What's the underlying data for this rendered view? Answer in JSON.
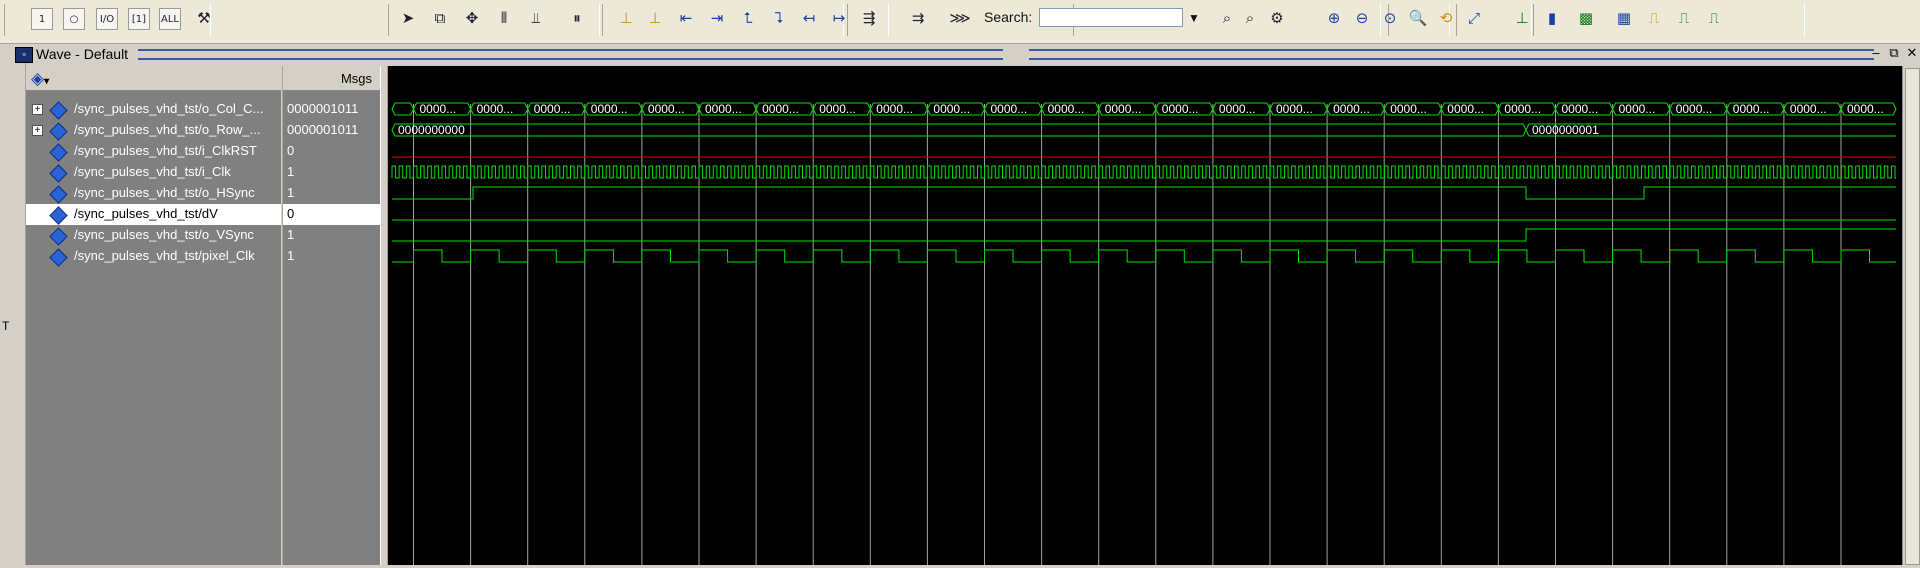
{
  "toolbar": {
    "search_label": "Search:",
    "search_value": "",
    "buttons": [
      {
        "name": "logic-1-icon",
        "glyph": "1"
      },
      {
        "name": "restart-icon",
        "glyph": "○"
      },
      {
        "name": "io-icon",
        "glyph": "I/O"
      },
      {
        "name": "bracket-icon",
        "glyph": "[1]"
      },
      {
        "name": "all-icon",
        "glyph": "ALL"
      },
      {
        "name": "tools-icon",
        "glyph": "⚒"
      },
      {
        "name": "select-cursor-icon",
        "glyph": "➤"
      },
      {
        "name": "zoom-box-icon",
        "glyph": "⧉"
      },
      {
        "name": "pan-icon",
        "glyph": "✥"
      },
      {
        "name": "cursor-pair-icon",
        "glyph": "⫴"
      },
      {
        "name": "insert-cursor-icon",
        "glyph": "⫫"
      },
      {
        "name": "stop-run-icon",
        "glyph": "⏸"
      },
      {
        "name": "add-cursor-icon",
        "glyph": "⊥"
      },
      {
        "name": "remove-cursor-icon",
        "glyph": "⊥"
      },
      {
        "name": "prev-edge-icon",
        "glyph": "⇤"
      },
      {
        "name": "next-edge-icon",
        "glyph": "⇥"
      },
      {
        "name": "prev-transition-icon",
        "glyph": "⮤"
      },
      {
        "name": "next-transition-icon",
        "glyph": "⮧"
      },
      {
        "name": "find-previous-icon",
        "glyph": "↤"
      },
      {
        "name": "find-next-icon",
        "glyph": "↦"
      },
      {
        "name": "expand-bus-icon",
        "glyph": "⇶"
      },
      {
        "name": "collapse-bus-icon",
        "glyph": "⇉"
      },
      {
        "name": "split-icon",
        "glyph": "⋙"
      },
      {
        "name": "search-previous-icon",
        "glyph": "⌕"
      },
      {
        "name": "search-next-icon",
        "glyph": "⌕"
      },
      {
        "name": "search-options-icon",
        "glyph": "⚙"
      },
      {
        "name": "zoom-in-icon",
        "glyph": "⊕"
      },
      {
        "name": "zoom-out-icon",
        "glyph": "⊖"
      },
      {
        "name": "zoom-full-icon",
        "glyph": "⊙"
      },
      {
        "name": "zoom-cursor-icon",
        "glyph": "🔍"
      },
      {
        "name": "zoom-last-icon",
        "glyph": "⟲"
      },
      {
        "name": "zoom-range-icon",
        "glyph": "⤢"
      },
      {
        "name": "wave-style-1-icon",
        "glyph": "⊥"
      },
      {
        "name": "wave-style-2-icon",
        "glyph": "▮"
      },
      {
        "name": "wave-style-3-icon",
        "glyph": "▩"
      },
      {
        "name": "wave-style-4-icon",
        "glyph": "▦"
      },
      {
        "name": "wave-style-5-icon",
        "glyph": "⎍"
      },
      {
        "name": "wave-style-6-icon",
        "glyph": "⎍"
      },
      {
        "name": "wave-style-7-icon",
        "glyph": "⎍"
      }
    ]
  },
  "window": {
    "title": "Wave - Default",
    "controls": [
      "–",
      "⧉",
      "✕"
    ]
  },
  "signal_panel": {
    "header_icon": "signal-list-icon",
    "value_header": "Msgs",
    "signals": [
      {
        "name": "/sync_pulses_vhd_tst/o_Col_C...",
        "value": "0000001011",
        "expandable": true,
        "selected": false
      },
      {
        "name": "/sync_pulses_vhd_tst/o_Row_...",
        "value": "0000001011",
        "expandable": true,
        "selected": false
      },
      {
        "name": "/sync_pulses_vhd_tst/i_ClkRST",
        "value": "0",
        "expandable": false,
        "selected": false
      },
      {
        "name": "/sync_pulses_vhd_tst/i_Clk",
        "value": "1",
        "expandable": false,
        "selected": false
      },
      {
        "name": "/sync_pulses_vhd_tst/o_HSync",
        "value": "1",
        "expandable": false,
        "selected": false
      },
      {
        "name": "/sync_pulses_vhd_tst/dV",
        "value": "0",
        "expandable": false,
        "selected": true
      },
      {
        "name": "/sync_pulses_vhd_tst/o_VSync",
        "value": "1",
        "expandable": false,
        "selected": false
      },
      {
        "name": "/sync_pulses_vhd_tst/pixel_Clk",
        "value": "1",
        "expandable": false,
        "selected": false
      }
    ]
  },
  "wave": {
    "wave_color": "#00e000",
    "reset_color": "#e00000",
    "grid_color": "#d8d8d8",
    "col_bus_label": "0000...",
    "row_bus_initial": "0000000000",
    "row_bus_after": "0000000001"
  },
  "side_label": "T"
}
